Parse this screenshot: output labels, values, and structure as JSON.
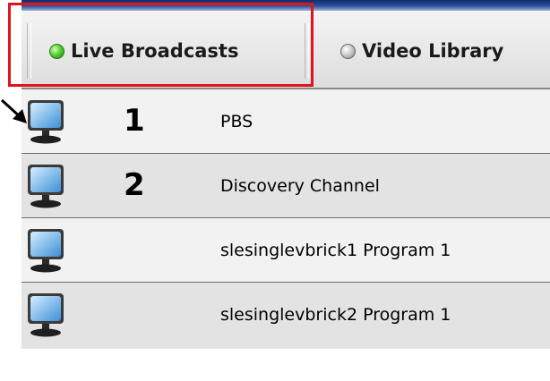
{
  "tabs": {
    "live": {
      "label": "Live Broadcasts",
      "indicator_color": "#3fc22a",
      "active": true
    },
    "library": {
      "label": "Video Library",
      "indicator_color": "#a8a8a8",
      "active": false
    }
  },
  "highlight_color": "#e0141e",
  "channels": [
    {
      "number": "1",
      "name": "PBS",
      "icon": "monitor-icon"
    },
    {
      "number": "2",
      "name": "Discovery Channel",
      "icon": "monitor-icon"
    },
    {
      "number": "",
      "name": "slesinglevbrick1 Program 1",
      "icon": "monitor-icon"
    },
    {
      "number": "",
      "name": "slesinglevbrick2 Program 1",
      "icon": "monitor-icon"
    }
  ]
}
